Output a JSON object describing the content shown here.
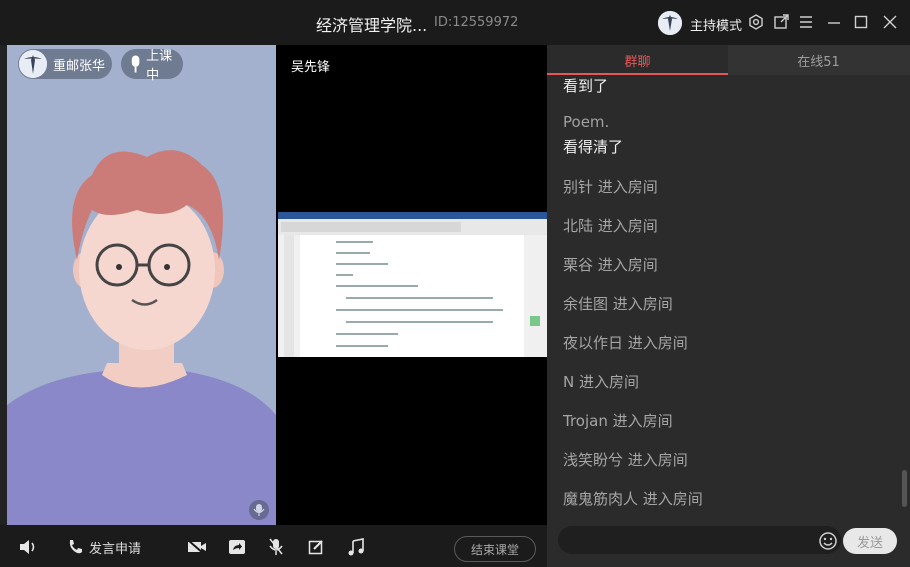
{
  "window": {
    "title": "经济管理学院...",
    "room_id": "ID:12559972",
    "host_mode_label": "主持模式"
  },
  "left_video": {
    "user_name": "重邮张华",
    "status": "上课中"
  },
  "mid_video": {
    "user_name": "吴先锋"
  },
  "toolbar": {
    "speak_request": "发言申请",
    "end_class": "结束课堂"
  },
  "chat": {
    "tabs": [
      {
        "label": "群聊"
      },
      {
        "label": "在线51"
      }
    ],
    "messages": [
      {
        "kind": "text",
        "text": "看到了"
      },
      {
        "kind": "sender",
        "text": "Poem."
      },
      {
        "kind": "text",
        "text": "看得清了"
      },
      {
        "kind": "join",
        "text": "别针 进入房间"
      },
      {
        "kind": "join",
        "text": "北陆 进入房间"
      },
      {
        "kind": "join",
        "text": "栗谷 进入房间"
      },
      {
        "kind": "join",
        "text": "余佳图 进入房间"
      },
      {
        "kind": "join",
        "text": "夜以作日 进入房间"
      },
      {
        "kind": "join",
        "text": "N 进入房间"
      },
      {
        "kind": "join",
        "text": "Trojan 进入房间"
      },
      {
        "kind": "join",
        "text": "浅笑盼兮 进入房间"
      },
      {
        "kind": "join",
        "text": "魔鬼筋肉人 进入房间"
      }
    ],
    "send_label": "发送"
  },
  "icons": {
    "settings": "gear-icon",
    "popout": "popout-icon",
    "menu": "hamburger-icon",
    "minimize": "minimize-icon",
    "maximize": "maximize-icon",
    "close": "close-icon"
  },
  "colors": {
    "accent": "#e85757",
    "background": "#1b1b1b",
    "video_bg": "#a3b1cf"
  }
}
